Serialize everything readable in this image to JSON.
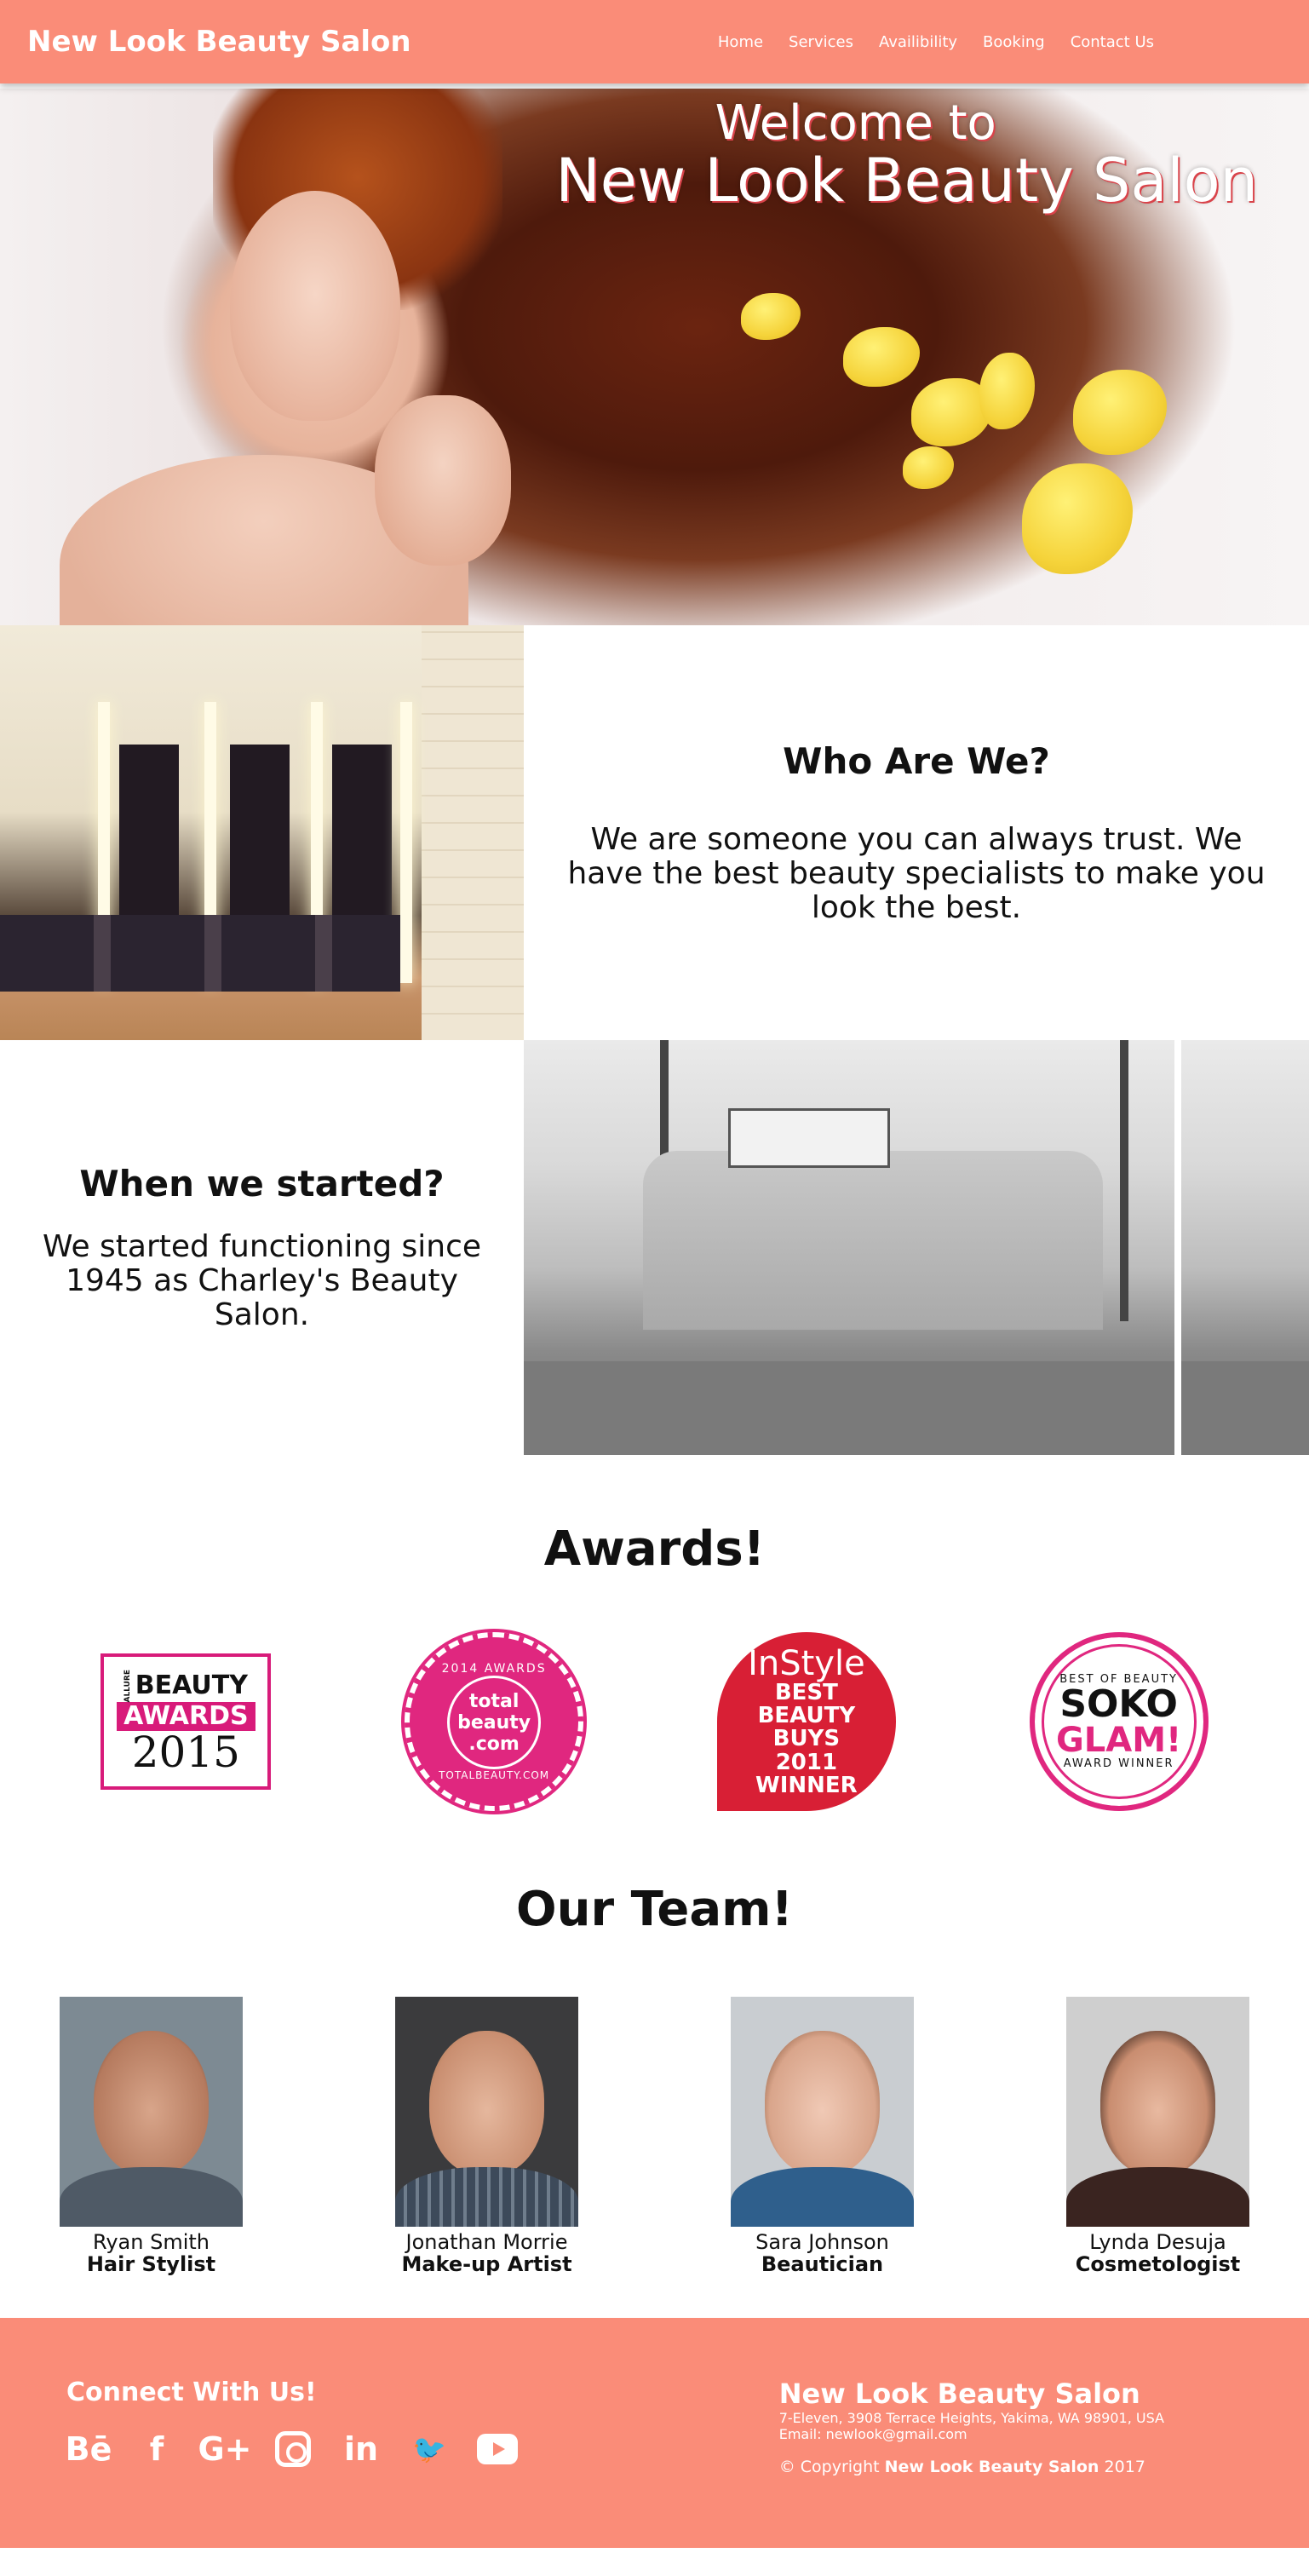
{
  "nav": {
    "brand": "New Look Beauty Salon",
    "links": [
      "Home",
      "Services",
      "Availibility",
      "Booking",
      "Contact Us"
    ]
  },
  "hero": {
    "line1": "Welcome to",
    "line2": "New Look Beauty Salon"
  },
  "about": {
    "title": "Who Are We?",
    "text": "We are someone you can always trust. We have the best beauty specialists to make you look the best."
  },
  "history": {
    "title": "When we started?",
    "text": "We started functioning since 1945 as Charley's Beauty Salon."
  },
  "awards": {
    "title": "Awards!",
    "items": [
      {
        "l0": "ALLURE",
        "l1": "BEAUTY",
        "l2": "AWARDS",
        "l3": "2015"
      },
      {
        "l0": "2014 AWARDS",
        "l1": "total beauty .com",
        "l2": "TOTALBEAUTY.COM"
      },
      {
        "l0": "InStyle",
        "l1": "BEST BEAUTY BUYS 2011",
        "l2": "WINNER"
      },
      {
        "l0": "BEST OF BEAUTY",
        "l1": "SOKO",
        "l2": "GLAM!",
        "l3": "AWARD WINNER"
      }
    ]
  },
  "team": {
    "title": "Our Team!",
    "members": [
      {
        "name": "Ryan Smith",
        "role": "Hair Stylist"
      },
      {
        "name": "Jonathan Morrie",
        "role": "Make-up Artist"
      },
      {
        "name": "Sara Johnson",
        "role": "Beautician"
      },
      {
        "name": "Lynda Desuja",
        "role": "Cosmetologist"
      }
    ]
  },
  "footer": {
    "connect": "Connect With Us!",
    "social": [
      "behance-icon",
      "facebook-icon",
      "google-plus-icon",
      "instagram-icon",
      "linkedin-icon",
      "twitter-icon",
      "youtube-icon"
    ],
    "social_glyphs": {
      "behance": "Bē",
      "facebook": "f",
      "google_plus": "G+",
      "linkedin": "in",
      "twitter": "🐦"
    },
    "name": "New Look Beauty Salon",
    "address": "7-Eleven, 3908 Terrace Heights, Yakima, WA 98901, USA",
    "email": "Email: newlook@gmail.com",
    "copy_prefix": "© Copyright",
    "copy_name": "New Look Beauty Salon",
    "copy_year": "2017"
  },
  "colors": {
    "accent": "#fa8c78",
    "pink": "#e0277f",
    "red": "#d81f35"
  }
}
